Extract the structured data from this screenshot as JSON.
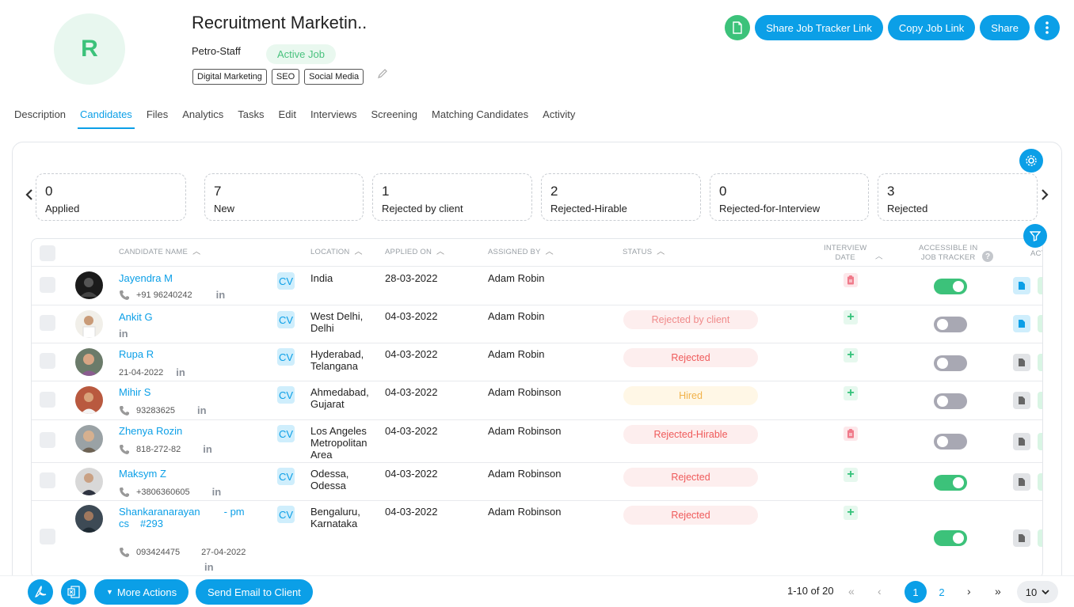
{
  "header": {
    "avatar_letter": "R",
    "job_title": "Recruitment Marketin..",
    "company": "Petro-Staff",
    "status_badge": "Active Job",
    "tags": [
      "Digital Marketing",
      "SEO",
      "Social Media"
    ],
    "actions": {
      "share_tracker": "Share Job Tracker Link",
      "copy_link": "Copy Job Link",
      "share": "Share"
    }
  },
  "tabs": [
    "Description",
    "Candidates",
    "Files",
    "Analytics",
    "Tasks",
    "Edit",
    "Interviews",
    "Screening",
    "Matching Candidates",
    "Activity"
  ],
  "active_tab": "Candidates",
  "stats": [
    {
      "count": "0",
      "label": "Applied"
    },
    {
      "count": "7",
      "label": "New"
    },
    {
      "count": "1",
      "label": "Rejected by client"
    },
    {
      "count": "2",
      "label": "Rejected-Hirable"
    },
    {
      "count": "0",
      "label": "Rejected-for-Interview"
    },
    {
      "count": "3",
      "label": "Rejected"
    }
  ],
  "table": {
    "headers": {
      "name": "Candidate Name",
      "location": "Location",
      "applied_on": "Applied On",
      "assigned_by": "Assigned By",
      "status": "Status",
      "interview_date_1": "Interview",
      "interview_date_2": "Date",
      "accessible_1": "Accessible in",
      "accessible_2": "Job Tracker",
      "actions": "Act"
    },
    "cv_label": "CV",
    "linkedin_label": "in",
    "rows": [
      {
        "name": "Jayendra M",
        "sub": "+91 96240242",
        "location": "India",
        "applied": "28-03-2022",
        "assigned": "Adam Robin",
        "status": "",
        "interview": "clip",
        "tracker": true
      },
      {
        "name": "Ankit G",
        "sub": "",
        "location": "West Delhi, Delhi",
        "applied": "04-03-2022",
        "assigned": "Adam Robin",
        "status": "Rejected by client",
        "interview": "plus",
        "tracker": false
      },
      {
        "name": "Rupa R",
        "sub": "21-04-2022",
        "location": "Hyderabad, Telangana",
        "applied": "04-03-2022",
        "assigned": "Adam Robin",
        "status": "Rejected",
        "interview": "plus",
        "tracker": false
      },
      {
        "name": "Mihir S",
        "sub": "93283625",
        "location": "Ahmedabad, Gujarat",
        "applied": "04-03-2022",
        "assigned": "Adam Robinson",
        "status": "Hired",
        "interview": "plus",
        "tracker": false
      },
      {
        "name": "Zhenya Rozin",
        "sub": "818-272-82",
        "location": "Los Angeles Metropolitan Area",
        "applied": "04-03-2022",
        "assigned": "Adam Robinson",
        "status": "Rejected-Hirable",
        "interview": "clip",
        "tracker": false
      },
      {
        "name": "Maksym Z",
        "sub": "+3806360605",
        "location": "Odessa, Odessa",
        "applied": "04-03-2022",
        "assigned": "Adam Robinson",
        "status": "Rejected",
        "interview": "plus",
        "tracker": true
      },
      {
        "name_line1": "Shankaranarayan",
        "name_line1b": "- pm",
        "name_line2": "cs",
        "name_line2b": "#293",
        "sub": "093424475",
        "sub_date": "27-04-2022",
        "location": "Bengaluru, Karnataka",
        "applied": "04-03-2022",
        "assigned": "Adam Robinson",
        "status": "Rejected",
        "interview": "plus",
        "tracker": true
      }
    ]
  },
  "footer": {
    "more_actions": "More Actions",
    "send_email": "Send Email to Client",
    "range": "1-10 of 20",
    "pages": [
      "1",
      "2"
    ],
    "page_size": "10"
  },
  "colors": {
    "accent": "#0b9fe7",
    "success": "#3cc27a",
    "danger": "#ef5a5a"
  }
}
